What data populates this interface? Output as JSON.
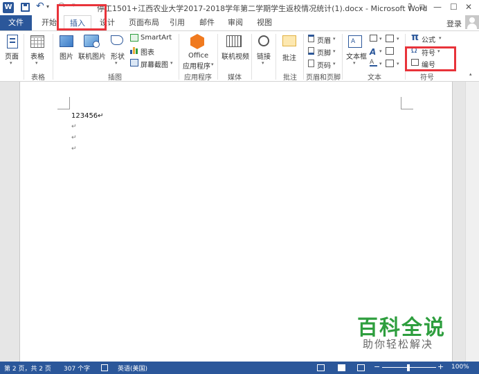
{
  "window": {
    "title": "停工1501+江西农业大学2017-2018学年第二学期学生返校情况统计(1).docx - Microsoft Word",
    "controls": [
      "?",
      "⧉",
      "—",
      "☐",
      "✕"
    ]
  },
  "quick_access": {
    "word_logo": "W",
    "undo": "↶",
    "redo": "↷"
  },
  "tabs": {
    "file": "文件",
    "items": [
      "开始",
      "插入",
      "设计",
      "页面布局",
      "引用",
      "邮件",
      "审阅",
      "视图"
    ],
    "active": "插入",
    "login": "登录"
  },
  "ribbon": {
    "pages": {
      "label": "页面",
      "group": ""
    },
    "tables": {
      "label": "表格",
      "group": "表格"
    },
    "illustrations": {
      "picture": "图片",
      "online_picture": "联机图片",
      "shapes": "形状",
      "smartart": "SmartArt",
      "chart": "图表",
      "screenshot": "屏幕截图",
      "group": "插图"
    },
    "apps": {
      "label_line1": "Office",
      "label_line2": "应用程序",
      "group": "应用程序"
    },
    "media": {
      "label": "联机视频",
      "group": "媒体"
    },
    "links": {
      "label": "链接",
      "group": ""
    },
    "comments": {
      "label": "批注",
      "group": "批注"
    },
    "header_footer": {
      "header": "页眉",
      "footer": "页脚",
      "page_number": "页码",
      "group": "页眉和页脚"
    },
    "text": {
      "textbox": "文本框",
      "group": "文本"
    },
    "symbols": {
      "equation": "公式",
      "symbol": "符号",
      "number": "编号",
      "group": "符号",
      "equation_glyph": "π",
      "symbol_glyph": "Ω"
    }
  },
  "document": {
    "lines": [
      "123456↵"
    ],
    "para_marks": [
      "↵",
      "↵",
      "↵"
    ]
  },
  "watermark": {
    "title": "百科全说",
    "subtitle": "助你轻松解决"
  },
  "status": {
    "page": "第 2 页，共 2 页",
    "words": "307 个字",
    "language": "英语(美国)",
    "zoom": "100%",
    "zoom_minus": "−",
    "zoom_plus": "+"
  },
  "colors": {
    "brand": "#2b579a",
    "highlight": "#e8333a",
    "watermark": "#2e9e3e"
  }
}
